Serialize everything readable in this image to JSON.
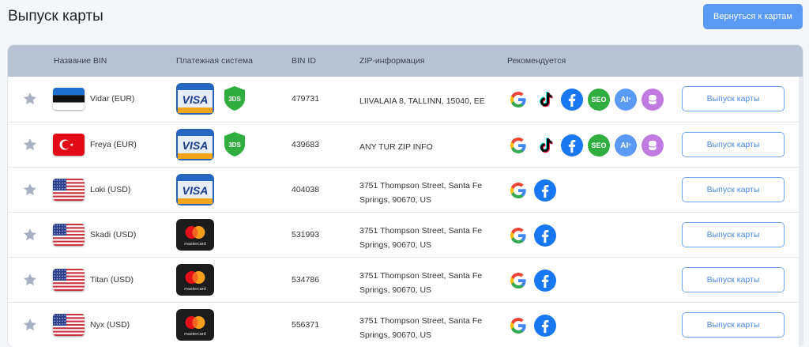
{
  "page": {
    "title": "Выпуск карты",
    "back_button": "Вернуться к картам"
  },
  "table": {
    "headers": [
      "Название BIN",
      "Платежная система",
      "BIN ID",
      "ZIP-информация",
      "Рекомендуется"
    ],
    "issue_label": "Выпуск карты",
    "rows": [
      {
        "name": "Vidar (EUR)",
        "flag": "estonia-flag",
        "card": "visa",
        "badge": "3DS",
        "bin": "479731",
        "zip": "LIIVALAIA 8, TALLINN, 15040, EE",
        "zip2": "",
        "recommended": [
          "google-icon",
          "tiktok-icon",
          "facebook-icon",
          "seo-icon",
          "ai-icon",
          "database-icon"
        ]
      },
      {
        "name": "Freya (EUR)",
        "flag": "turkey-flag",
        "card": "visa",
        "badge": "3DS",
        "bin": "439683",
        "zip": "ANY TUR ZIP INFO",
        "zip2": "",
        "recommended": [
          "google-icon",
          "tiktok-icon",
          "facebook-icon",
          "seo-icon",
          "ai-icon",
          "database-icon"
        ]
      },
      {
        "name": "Loki (USD)",
        "flag": "usa-flag",
        "card": "visa",
        "badge": "",
        "bin": "404038",
        "zip": "3751 Thompson Street, Santa Fe",
        "zip2": "Springs, 90670, US",
        "recommended": [
          "google-icon",
          "facebook-icon"
        ]
      },
      {
        "name": "Skadi (USD)",
        "flag": "usa-flag",
        "card": "mastercard",
        "badge": "",
        "bin": "531993",
        "zip": "3751 Thompson Street, Santa Fe",
        "zip2": "Springs, 90670, US",
        "recommended": [
          "google-icon",
          "facebook-icon"
        ]
      },
      {
        "name": "Titan (USD)",
        "flag": "usa-flag",
        "card": "mastercard",
        "badge": "",
        "bin": "534786",
        "zip": "3751 Thompson Street, Santa Fe",
        "zip2": "Springs, 90670, US",
        "recommended": [
          "google-icon",
          "facebook-icon"
        ]
      },
      {
        "name": "Nyx (USD)",
        "flag": "usa-flag",
        "card": "mastercard",
        "badge": "",
        "bin": "556371",
        "zip": "3751 Thompson Street, Santa Fe",
        "zip2": "Springs, 90670, US",
        "recommended": [
          "google-icon",
          "facebook-icon"
        ]
      }
    ]
  },
  "colors": {
    "accent": "#5a9af5",
    "header_bg": "#b7c2d2",
    "star": "#a7b1c2"
  },
  "card_text": {
    "visa": "VISA",
    "mastercard": "mastercard"
  }
}
